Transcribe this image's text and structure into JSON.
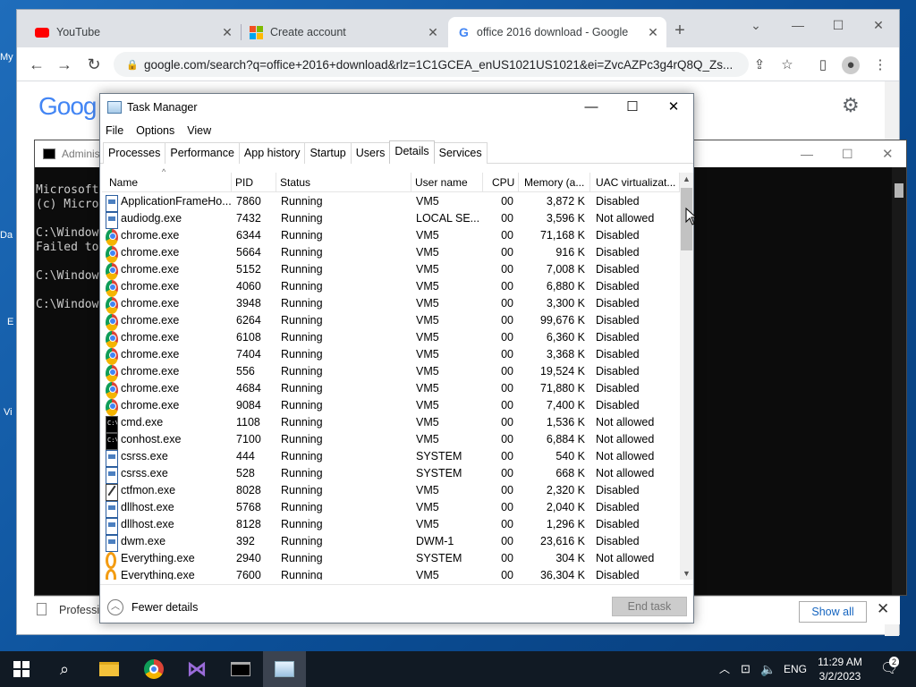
{
  "desktop": {
    "icons": [
      "My",
      "Da",
      "E",
      "Vi"
    ]
  },
  "chrome": {
    "tabs": [
      {
        "title": "YouTube",
        "close": "✕"
      },
      {
        "title": "Create account",
        "close": "✕"
      },
      {
        "title": "office 2016 download - Google S",
        "close": "✕"
      }
    ],
    "new_tab": "+",
    "url": "google.com/search?q=office+2016+download&rlz=1C1GCEA_enUS1021US1021&ei=ZvcAZPc3g4rQ8Q_Zs...",
    "logo": "Goog"
  },
  "cmd": {
    "title": "Adminis",
    "lines": [
      "Microsoft",
      "(c) Micro",
      "",
      "C:\\Window",
      "Failed to",
      "",
      "C:\\Window",
      "",
      "C:\\Window"
    ]
  },
  "banner": {
    "text": "Professi",
    "show_all": "Show all",
    "close": "✕"
  },
  "taskmanager": {
    "title": "Task Manager",
    "menu": [
      "File",
      "Options",
      "View"
    ],
    "tabs": [
      "Processes",
      "Performance",
      "App history",
      "Startup",
      "Users",
      "Details",
      "Services"
    ],
    "active_tab": "Details",
    "columns": [
      "Name",
      "PID",
      "Status",
      "User name",
      "CPU",
      "Memory (a...",
      "UAC virtualizat..."
    ],
    "rows": [
      {
        "icon": "app",
        "name": "ApplicationFrameHo...",
        "pid": "7860",
        "status": "Running",
        "user": "VM5",
        "cpu": "00",
        "mem": "3,872 K",
        "uac": "Disabled"
      },
      {
        "icon": "app",
        "name": "audiodg.exe",
        "pid": "7432",
        "status": "Running",
        "user": "LOCAL SE...",
        "cpu": "00",
        "mem": "3,596 K",
        "uac": "Not allowed"
      },
      {
        "icon": "chrome",
        "name": "chrome.exe",
        "pid": "6344",
        "status": "Running",
        "user": "VM5",
        "cpu": "00",
        "mem": "71,168 K",
        "uac": "Disabled"
      },
      {
        "icon": "chrome",
        "name": "chrome.exe",
        "pid": "5664",
        "status": "Running",
        "user": "VM5",
        "cpu": "00",
        "mem": "916 K",
        "uac": "Disabled"
      },
      {
        "icon": "chrome",
        "name": "chrome.exe",
        "pid": "5152",
        "status": "Running",
        "user": "VM5",
        "cpu": "00",
        "mem": "7,008 K",
        "uac": "Disabled"
      },
      {
        "icon": "chrome",
        "name": "chrome.exe",
        "pid": "4060",
        "status": "Running",
        "user": "VM5",
        "cpu": "00",
        "mem": "6,880 K",
        "uac": "Disabled"
      },
      {
        "icon": "chrome",
        "name": "chrome.exe",
        "pid": "3948",
        "status": "Running",
        "user": "VM5",
        "cpu": "00",
        "mem": "3,300 K",
        "uac": "Disabled"
      },
      {
        "icon": "chrome",
        "name": "chrome.exe",
        "pid": "6264",
        "status": "Running",
        "user": "VM5",
        "cpu": "00",
        "mem": "99,676 K",
        "uac": "Disabled"
      },
      {
        "icon": "chrome",
        "name": "chrome.exe",
        "pid": "6108",
        "status": "Running",
        "user": "VM5",
        "cpu": "00",
        "mem": "6,360 K",
        "uac": "Disabled"
      },
      {
        "icon": "chrome",
        "name": "chrome.exe",
        "pid": "7404",
        "status": "Running",
        "user": "VM5",
        "cpu": "00",
        "mem": "3,368 K",
        "uac": "Disabled"
      },
      {
        "icon": "chrome",
        "name": "chrome.exe",
        "pid": "556",
        "status": "Running",
        "user": "VM5",
        "cpu": "00",
        "mem": "19,524 K",
        "uac": "Disabled"
      },
      {
        "icon": "chrome",
        "name": "chrome.exe",
        "pid": "4684",
        "status": "Running",
        "user": "VM5",
        "cpu": "00",
        "mem": "71,880 K",
        "uac": "Disabled"
      },
      {
        "icon": "chrome",
        "name": "chrome.exe",
        "pid": "9084",
        "status": "Running",
        "user": "VM5",
        "cpu": "00",
        "mem": "7,400 K",
        "uac": "Disabled"
      },
      {
        "icon": "cmd",
        "name": "cmd.exe",
        "pid": "1108",
        "status": "Running",
        "user": "VM5",
        "cpu": "00",
        "mem": "1,536 K",
        "uac": "Not allowed"
      },
      {
        "icon": "cmd",
        "name": "conhost.exe",
        "pid": "7100",
        "status": "Running",
        "user": "VM5",
        "cpu": "00",
        "mem": "6,884 K",
        "uac": "Not allowed"
      },
      {
        "icon": "app",
        "name": "csrss.exe",
        "pid": "444",
        "status": "Running",
        "user": "SYSTEM",
        "cpu": "00",
        "mem": "540 K",
        "uac": "Not allowed"
      },
      {
        "icon": "app",
        "name": "csrss.exe",
        "pid": "528",
        "status": "Running",
        "user": "SYSTEM",
        "cpu": "00",
        "mem": "668 K",
        "uac": "Not allowed"
      },
      {
        "icon": "ctf",
        "name": "ctfmon.exe",
        "pid": "8028",
        "status": "Running",
        "user": "VM5",
        "cpu": "00",
        "mem": "2,320 K",
        "uac": "Disabled"
      },
      {
        "icon": "app",
        "name": "dllhost.exe",
        "pid": "5768",
        "status": "Running",
        "user": "VM5",
        "cpu": "00",
        "mem": "2,040 K",
        "uac": "Disabled"
      },
      {
        "icon": "app",
        "name": "dllhost.exe",
        "pid": "8128",
        "status": "Running",
        "user": "VM5",
        "cpu": "00",
        "mem": "1,296 K",
        "uac": "Disabled"
      },
      {
        "icon": "app",
        "name": "dwm.exe",
        "pid": "392",
        "status": "Running",
        "user": "DWM-1",
        "cpu": "00",
        "mem": "23,616 K",
        "uac": "Disabled"
      },
      {
        "icon": "every",
        "name": "Everything.exe",
        "pid": "2940",
        "status": "Running",
        "user": "SYSTEM",
        "cpu": "00",
        "mem": "304 K",
        "uac": "Not allowed"
      },
      {
        "icon": "every",
        "name": "Everything.exe",
        "pid": "7600",
        "status": "Running",
        "user": "VM5",
        "cpu": "00",
        "mem": "36,304 K",
        "uac": "Disabled"
      }
    ],
    "fewer_details": "Fewer details",
    "end_task": "End task"
  },
  "taskbar": {
    "lang": "ENG",
    "time": "11:29 AM",
    "date": "3/2/2023",
    "notifications": "2"
  },
  "colors": {
    "accent": "#1a73e8",
    "taskbar": "#111a24",
    "end_task_disabled": "#cccccc"
  }
}
